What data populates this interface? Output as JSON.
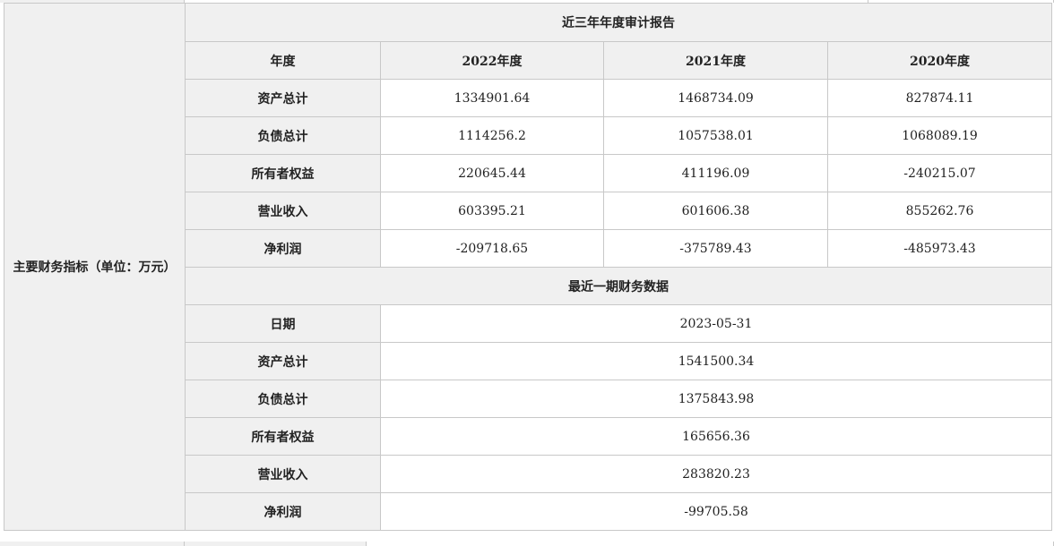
{
  "side_label": "主要财务指标（单位：万元）",
  "annual": {
    "title": "近三年年度审计报告",
    "header": [
      "年度",
      "2022年度",
      "2021年度",
      "2020年度"
    ],
    "rows": [
      {
        "label": "资产总计",
        "values": [
          "1334901.64",
          "1468734.09",
          "827874.11"
        ]
      },
      {
        "label": "负债总计",
        "values": [
          "1114256.2",
          "1057538.01",
          "1068089.19"
        ]
      },
      {
        "label": "所有者权益",
        "values": [
          "220645.44",
          "411196.09",
          "-240215.07"
        ]
      },
      {
        "label": "营业收入",
        "values": [
          "603395.21",
          "601606.38",
          "855262.76"
        ]
      },
      {
        "label": "净利润",
        "values": [
          "-209718.65",
          "-375789.43",
          "-485973.43"
        ]
      }
    ]
  },
  "recent": {
    "title": "最近一期财务数据",
    "rows": [
      {
        "label": "日期",
        "value": "2023-05-31"
      },
      {
        "label": "资产总计",
        "value": "1541500.34"
      },
      {
        "label": "负债总计",
        "value": "1375843.98"
      },
      {
        "label": "所有者权益",
        "value": "165656.36"
      },
      {
        "label": "营业收入",
        "value": "283820.23"
      },
      {
        "label": "净利润",
        "value": "-99705.58"
      }
    ]
  }
}
